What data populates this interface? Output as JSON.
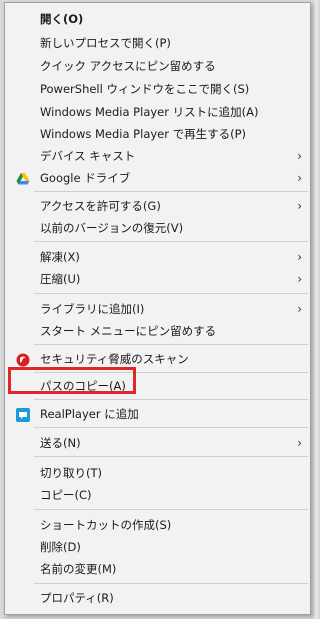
{
  "menu": {
    "items": [
      {
        "label": "開く(O)"
      },
      {
        "label": "新しいプロセスで開く(P)"
      },
      {
        "label": "クイック アクセスにピン留めする"
      },
      {
        "label": "PowerShell ウィンドウをここで開く(S)"
      },
      {
        "label": "Windows Media Player リストに追加(A)"
      },
      {
        "label": "Windows Media Player で再生する(P)"
      },
      {
        "label": "デバイス キャスト",
        "submenu": true
      },
      {
        "label": "Google ドライブ",
        "submenu": true,
        "icon": "google-drive-icon"
      },
      {
        "label": "アクセスを許可する(G)",
        "submenu": true
      },
      {
        "label": "以前のバージョンの復元(V)"
      },
      {
        "label": "解凍(X)",
        "submenu": true
      },
      {
        "label": "圧縮(U)",
        "submenu": true
      },
      {
        "label": "ライブラリに追加(I)",
        "submenu": true
      },
      {
        "label": "スタート メニューにピン留めする"
      },
      {
        "label": "セキュリティ脅威のスキャン",
        "icon": "security-scan-icon"
      },
      {
        "label": "パスのコピー(A)"
      },
      {
        "label": "RealPlayer に追加",
        "icon": "realplayer-icon"
      },
      {
        "label": "送る(N)",
        "submenu": true
      },
      {
        "label": "切り取り(T)"
      },
      {
        "label": "コピー(C)"
      },
      {
        "label": "ショートカットの作成(S)"
      },
      {
        "label": "削除(D)"
      },
      {
        "label": "名前の変更(M)"
      },
      {
        "label": "プロパティ(R)"
      }
    ],
    "submenu_arrow": "›"
  },
  "highlight_color": "#e0262b"
}
